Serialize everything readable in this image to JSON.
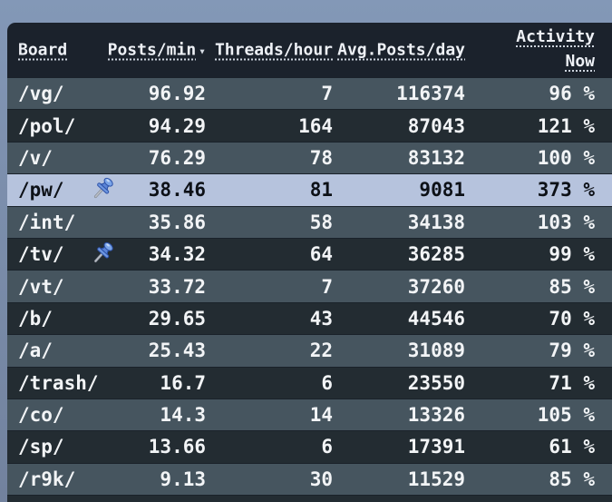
{
  "table": {
    "sorted_by": "Posts/min",
    "sort_direction": "descending",
    "columns": [
      {
        "label": "Board"
      },
      {
        "label": "Posts/min",
        "sort_indicator": "▾"
      },
      {
        "label": "Threads/hour"
      },
      {
        "label": "Avg.Posts/day"
      },
      {
        "label": "Activity",
        "label_line2": "Now"
      }
    ],
    "rows": [
      {
        "board": "/vg/",
        "posts_min": "96.92",
        "threads_hour": "7",
        "avg_posts_day": "116374",
        "activity": "96 %",
        "pinned": false,
        "highlighted": false
      },
      {
        "board": "/pol/",
        "posts_min": "94.29",
        "threads_hour": "164",
        "avg_posts_day": "87043",
        "activity": "121 %",
        "pinned": false,
        "highlighted": false
      },
      {
        "board": "/v/",
        "posts_min": "76.29",
        "threads_hour": "78",
        "avg_posts_day": "83132",
        "activity": "100 %",
        "pinned": false,
        "highlighted": false
      },
      {
        "board": "/pw/",
        "posts_min": "38.46",
        "threads_hour": "81",
        "avg_posts_day": "9081",
        "activity": "373 %",
        "pinned": true,
        "highlighted": true
      },
      {
        "board": "/int/",
        "posts_min": "35.86",
        "threads_hour": "58",
        "avg_posts_day": "34138",
        "activity": "103 %",
        "pinned": false,
        "highlighted": false
      },
      {
        "board": "/tv/",
        "posts_min": "34.32",
        "threads_hour": "64",
        "avg_posts_day": "36285",
        "activity": "99 %",
        "pinned": true,
        "highlighted": false
      },
      {
        "board": "/vt/",
        "posts_min": "33.72",
        "threads_hour": "7",
        "avg_posts_day": "37260",
        "activity": "85 %",
        "pinned": false,
        "highlighted": false
      },
      {
        "board": "/b/",
        "posts_min": "29.65",
        "threads_hour": "43",
        "avg_posts_day": "44546",
        "activity": "70 %",
        "pinned": false,
        "highlighted": false
      },
      {
        "board": "/a/",
        "posts_min": "25.43",
        "threads_hour": "22",
        "avg_posts_day": "31089",
        "activity": "79 %",
        "pinned": false,
        "highlighted": false
      },
      {
        "board": "/trash/",
        "posts_min": "16.7",
        "threads_hour": "6",
        "avg_posts_day": "23550",
        "activity": "71 %",
        "pinned": false,
        "highlighted": false
      },
      {
        "board": "/co/",
        "posts_min": "14.3",
        "threads_hour": "14",
        "avg_posts_day": "13326",
        "activity": "105 %",
        "pinned": false,
        "highlighted": false
      },
      {
        "board": "/sp/",
        "posts_min": "13.66",
        "threads_hour": "6",
        "avg_posts_day": "17391",
        "activity": "61 %",
        "pinned": false,
        "highlighted": false
      },
      {
        "board": "/r9k/",
        "posts_min": "9.13",
        "threads_hour": "30",
        "avg_posts_day": "11529",
        "activity": "85 %",
        "pinned": false,
        "highlighted": false
      }
    ]
  },
  "icons": {
    "pinned_board": "pushpin-icon",
    "sort_descending": "chevron-down-icon"
  },
  "colors": {
    "page_background": "#7d90ae",
    "header_background": "#1b222c",
    "row_slate": "#46555f",
    "row_dark": "#232c32",
    "row_highlight": "#b6c3dd",
    "text_light": "#f2f4f6",
    "text_dark": "#0d1117",
    "pin_blue": "#5b8bdc"
  }
}
